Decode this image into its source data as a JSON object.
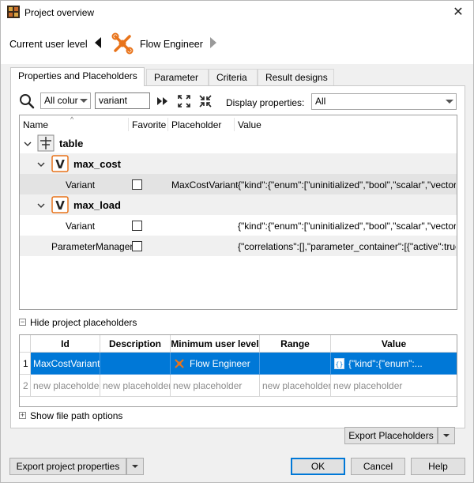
{
  "window": {
    "title": "Project overview",
    "close_label": "✕"
  },
  "user_level": {
    "label": "Current user level",
    "name": "Flow Engineer"
  },
  "tabs": [
    {
      "label": "Properties and Placeholders",
      "active": true
    },
    {
      "label": "Parameter",
      "active": false
    },
    {
      "label": "Criteria",
      "active": false
    },
    {
      "label": "Result designs",
      "active": false
    }
  ],
  "filter": {
    "column_select": "All colur",
    "search_value": "variant",
    "display_label": "Display properties:",
    "display_select": "All"
  },
  "tree": {
    "headers": {
      "name": "Name",
      "favorite": "Favorite",
      "placeholder": "Placeholder",
      "value": "Value"
    },
    "rows": [
      {
        "name": "table",
        "placeholder": "",
        "value": ""
      },
      {
        "name": "max_cost",
        "placeholder": "",
        "value": ""
      },
      {
        "name": "Variant",
        "placeholder": "MaxCostVariant",
        "value": "{\"kind\":{\"enum\":[\"uninitialized\",\"bool\",\"scalar\",\"vector\"..."
      },
      {
        "name": "max_load",
        "placeholder": "",
        "value": ""
      },
      {
        "name": "Variant",
        "placeholder": "",
        "value": "{\"kind\":{\"enum\":[\"uninitialized\",\"bool\",\"scalar\",\"vector\"..."
      },
      {
        "name": "ParameterManager",
        "placeholder": "",
        "value": "{\"correlations\":[],\"parameter_container\":[{\"active\":true,..."
      }
    ]
  },
  "placeholders": {
    "toggle_label": "Hide project placeholders",
    "toggle_symbol": "−",
    "headers": {
      "id": "Id",
      "description": "Description",
      "min_level": "Minimum user level",
      "range": "Range",
      "value": "Value"
    },
    "rows": [
      {
        "num": "1",
        "id": "MaxCostVariant",
        "description": "",
        "min_level": "Flow Engineer",
        "range": "",
        "value": "{\"kind\":{\"enum\":..."
      },
      {
        "num": "2",
        "id": "new placeholder",
        "description": "new placeholder",
        "min_level": "new placeholder",
        "range": "new placeholder",
        "value": "new placeholder"
      }
    ]
  },
  "file_path": {
    "toggle_label": "Show file path options",
    "toggle_symbol": "+"
  },
  "buttons": {
    "export_placeholders": "Export Placeholders",
    "export_properties": "Export project properties",
    "ok": "OK",
    "cancel": "Cancel",
    "help": "Help"
  },
  "colors": {
    "selection": "#0078d7",
    "accent_orange": "#e8731a"
  }
}
